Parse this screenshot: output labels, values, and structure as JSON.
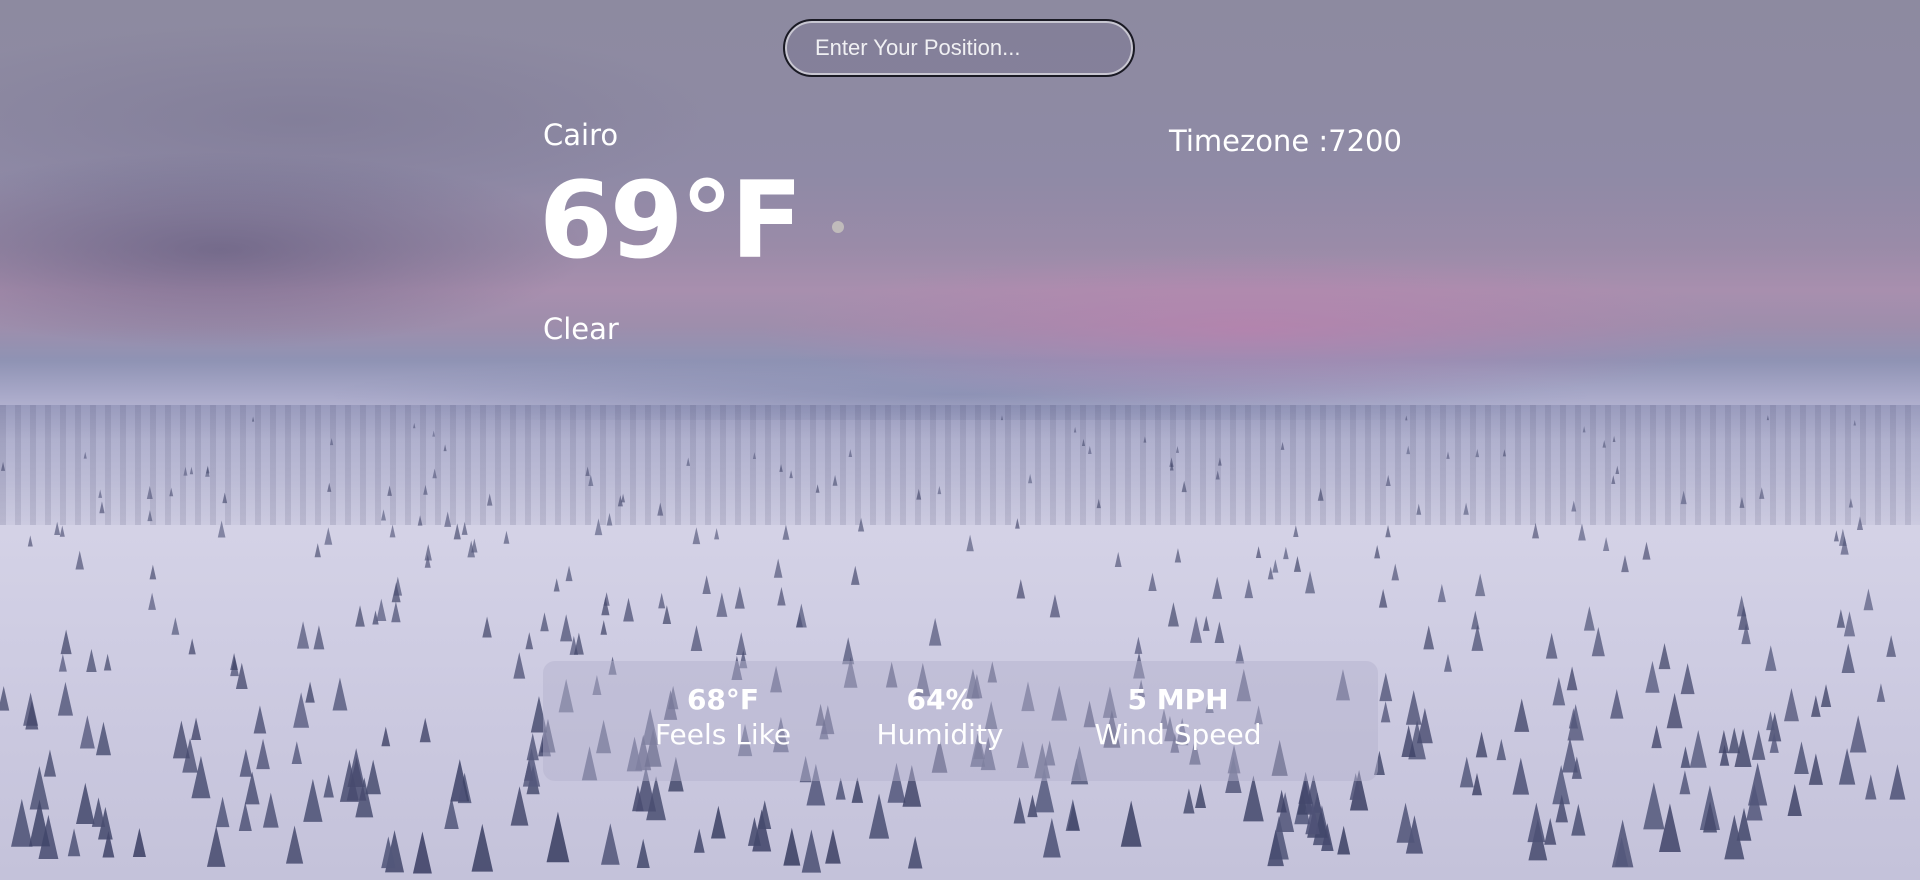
{
  "search": {
    "placeholder": "Enter Your Position..."
  },
  "weather": {
    "city": "Cairo",
    "temperature": "69°F",
    "condition": "Clear",
    "timezone": "Timezone :7200"
  },
  "details": [
    {
      "value": "68°F",
      "label": "Feels Like"
    },
    {
      "value": "64%",
      "label": "Humidity"
    },
    {
      "value": "5 MPH",
      "label": "Wind Speed"
    }
  ],
  "colors": {
    "text": "#ffffff",
    "panel": "#b4b2cd",
    "sky_top": "#8d8aa0",
    "horizon_pink": "#a88fae",
    "snow": "#d4d2e6"
  }
}
